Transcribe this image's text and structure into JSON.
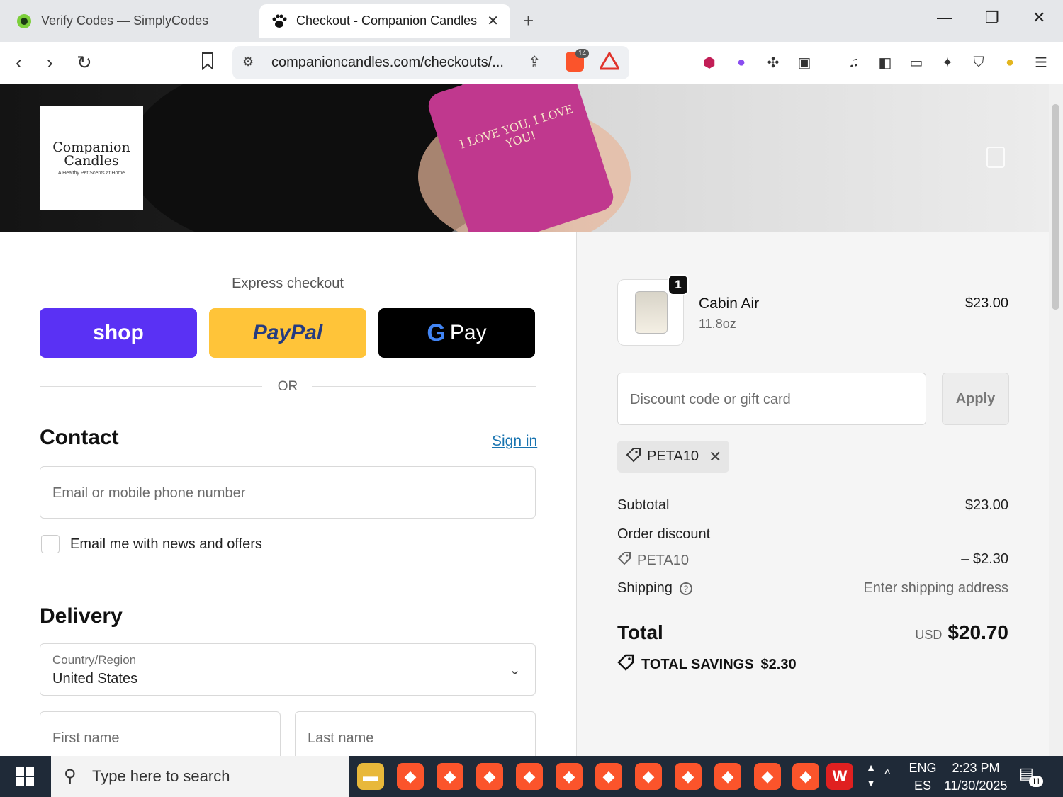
{
  "browser": {
    "tabs": [
      {
        "title": "Verify Codes — SimplyCodes",
        "active": false
      },
      {
        "title": "Checkout - Companion Candles",
        "active": true
      }
    ],
    "url": "companioncandles.com/checkouts/...",
    "shield_count": "14"
  },
  "hero": {
    "logo_line1": "Companion",
    "logo_line2": "Candles",
    "logo_tagline": "A Healthy Pet Scents at Home",
    "candle_text": "I LOVE YOU, I LOVE YOU!"
  },
  "express": {
    "label": "Express checkout",
    "shop": "shop",
    "paypal": "PayPal",
    "gpay": "Pay",
    "or": "OR"
  },
  "contact": {
    "heading": "Contact",
    "signin": "Sign in",
    "email_placeholder": "Email or mobile phone number",
    "news_label": "Email me with news and offers"
  },
  "delivery": {
    "heading": "Delivery",
    "country_label": "Country/Region",
    "country_value": "United States",
    "first_name": "First name",
    "last_name": "Last name"
  },
  "summary": {
    "quantity": "1",
    "product_name": "Cabin Air",
    "product_variant": "11.8oz",
    "product_price": "$23.00",
    "discount_placeholder": "Discount code or gift card",
    "apply": "Apply",
    "applied_code": "PETA10",
    "subtotal_label": "Subtotal",
    "subtotal_value": "$23.00",
    "order_discount_label": "Order discount",
    "discount_code": "PETA10",
    "discount_value": "– $2.30",
    "shipping_label": "Shipping",
    "shipping_value": "Enter shipping address",
    "total_label": "Total",
    "currency": "USD",
    "total_value": "$20.70",
    "savings_label": "TOTAL SAVINGS",
    "savings_value": "$2.30"
  },
  "taskbar": {
    "search_placeholder": "Type here to search",
    "lang_top": "ENG",
    "lang_bottom": "ES",
    "time": "2:23 PM",
    "date": "11/30/2025",
    "notifications": "11"
  }
}
